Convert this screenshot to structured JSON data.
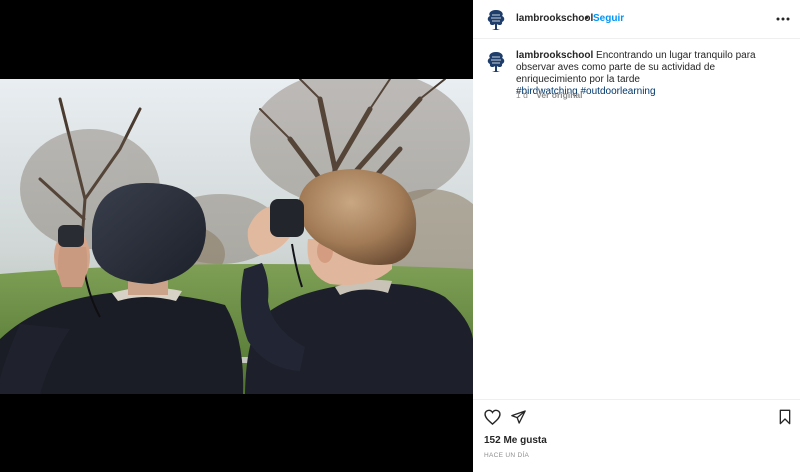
{
  "post": {
    "username": "lambrookschool",
    "follow_label": "Seguir",
    "header_separator": "•",
    "caption": {
      "username": "lambrookschool",
      "text": "Encontrando un lugar tranquilo para observar aves como parte de su actividad de enriquecimiento por la tarde",
      "hashtags": [
        "#birdwatching",
        "#outdoorlearning"
      ]
    },
    "age": "1 d",
    "see_translation_label": "Ver original",
    "likes": "152 Me gusta",
    "timestamp": "HACE UN DÍA"
  },
  "icons": {
    "avatar": "oak-tree-logo-icon",
    "more": "more-options-icon",
    "like": "heart-icon",
    "share": "paper-plane-icon",
    "save": "bookmark-icon"
  },
  "colors": {
    "link_blue": "#0095f6",
    "hashtag_blue": "#00376b",
    "logo_navy": "#1f3d6b",
    "muted": "#8e8e8e"
  }
}
